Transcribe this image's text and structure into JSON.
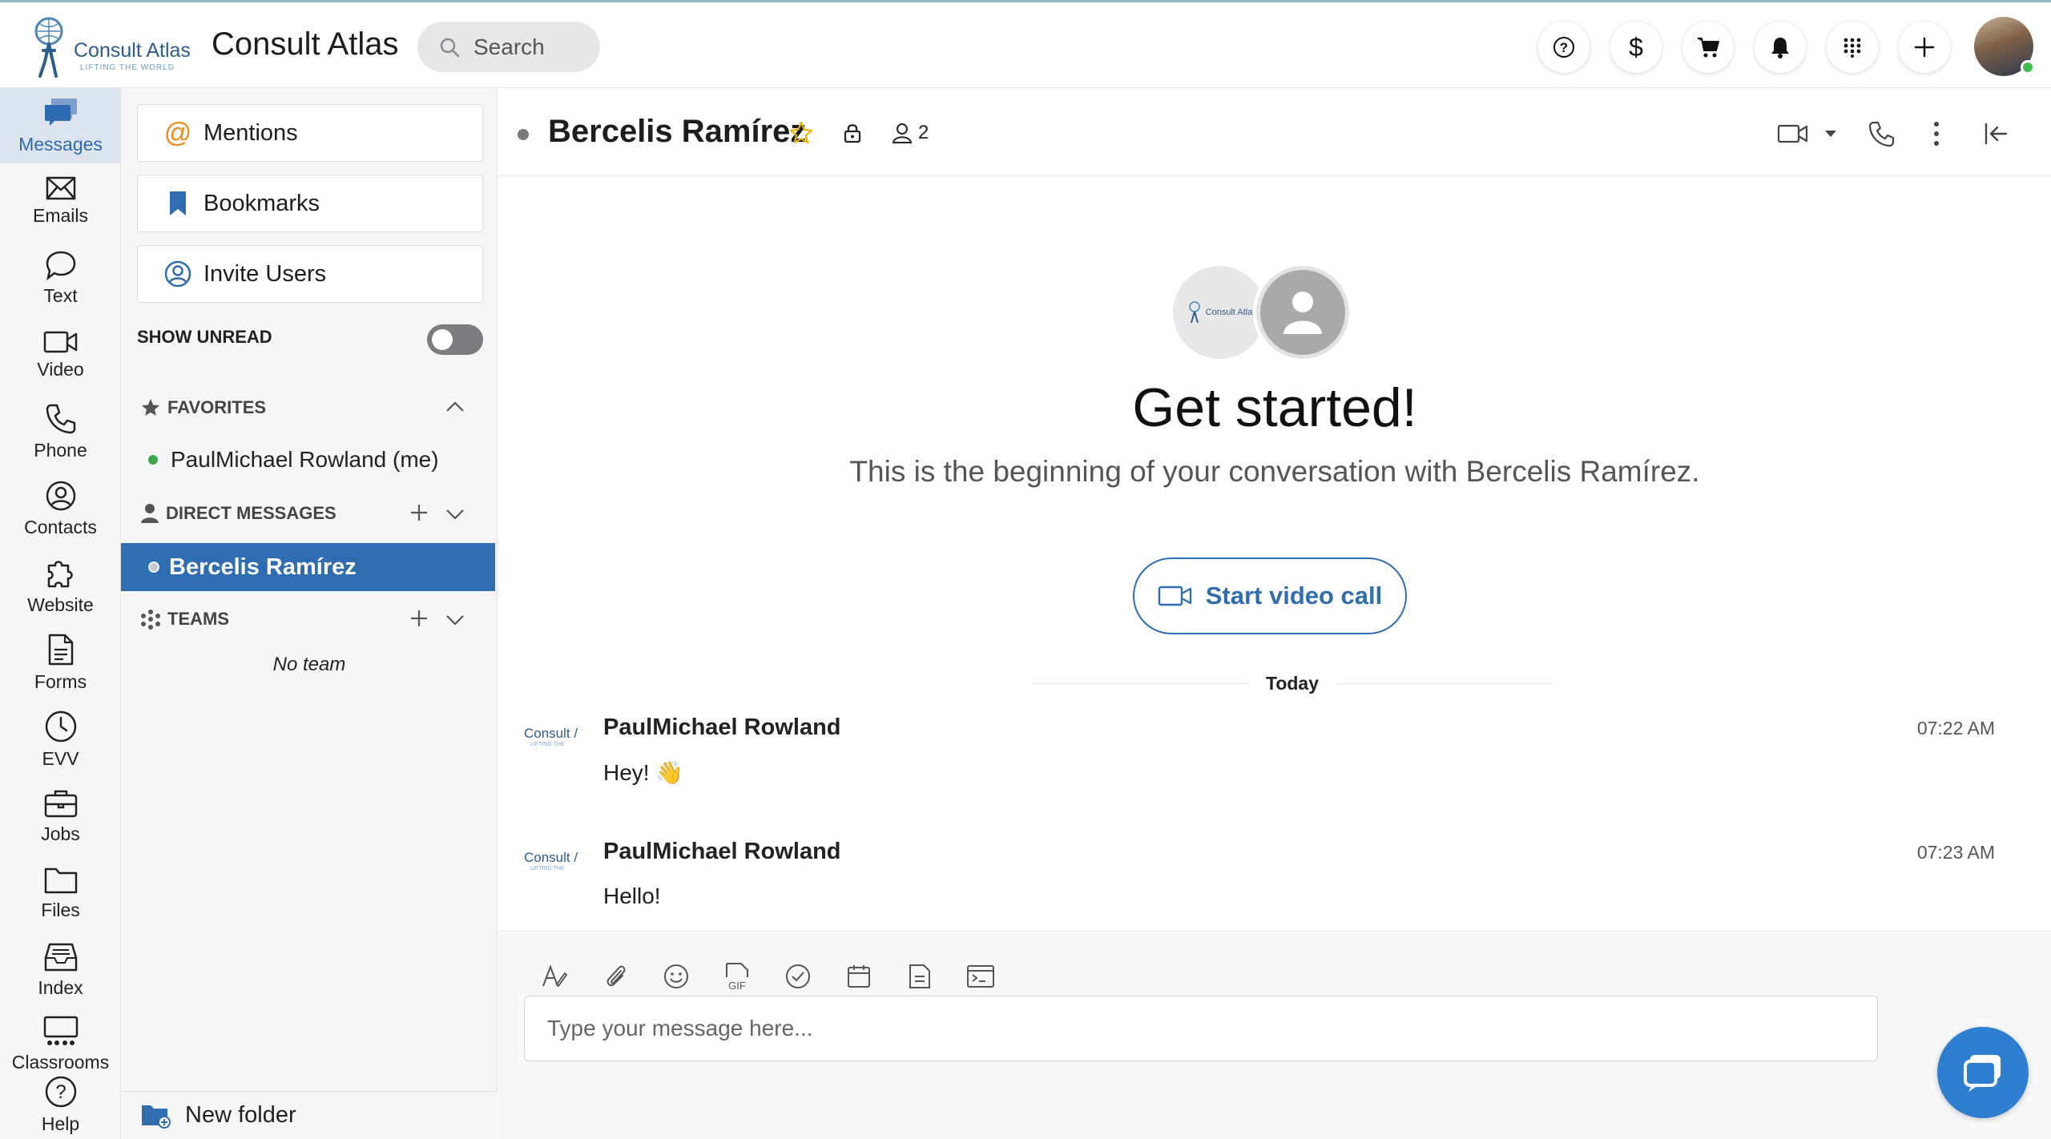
{
  "topbar": {
    "logo_brand": "Consult Atlas",
    "logo_tagline": "LIFTING THE WORLD",
    "app_title": "Consult Atlas",
    "search_placeholder": "Search",
    "buttons": [
      "help-icon",
      "dollar-icon",
      "cart-icon",
      "bell-icon",
      "apps-grid-icon",
      "plus-icon"
    ]
  },
  "rail": {
    "items": [
      {
        "label": "Messages",
        "icon": "messages-icon",
        "active": true
      },
      {
        "label": "Emails",
        "icon": "mail-icon"
      },
      {
        "label": "Text",
        "icon": "chat-bubble-icon"
      },
      {
        "label": "Video",
        "icon": "video-camera-icon"
      },
      {
        "label": "Phone",
        "icon": "phone-icon"
      },
      {
        "label": "Contacts",
        "icon": "contacts-icon"
      },
      {
        "label": "Website",
        "icon": "puzzle-icon"
      },
      {
        "label": "Forms",
        "icon": "document-icon"
      },
      {
        "label": "EVV",
        "icon": "clock-icon"
      },
      {
        "label": "Jobs",
        "icon": "briefcase-icon"
      },
      {
        "label": "Files",
        "icon": "folder-icon"
      },
      {
        "label": "Index",
        "icon": "inbox-icon"
      },
      {
        "label": "Classrooms",
        "icon": "classroom-icon"
      },
      {
        "label": "Help",
        "icon": "help-circle-icon"
      }
    ]
  },
  "sidebar": {
    "mentions": "Mentions",
    "bookmarks": "Bookmarks",
    "invite_users": "Invite Users",
    "show_unread": "SHOW UNREAD",
    "show_unread_on": false,
    "favorites_label": "FAVORITES",
    "favorites": [
      "PaulMichael Rowland (me)"
    ],
    "direct_messages_label": "DIRECT MESSAGES",
    "direct_messages": [
      "Bercelis Ramírez"
    ],
    "teams_label": "TEAMS",
    "no_team": "No team",
    "new_folder": "New folder"
  },
  "channel": {
    "name": "Bercelis Ramírez",
    "member_count": "2",
    "colors": {
      "accent": "#2f6db0",
      "star": "#e8b100"
    }
  },
  "welcome": {
    "avatar_logo_text": "Consult Atla",
    "title": "Get started!",
    "subtitle": "This is the beginning of your conversation with Bercelis Ramírez.",
    "video_button": "Start video call"
  },
  "day_separator": "Today",
  "messages": [
    {
      "logo_text": "Consult /",
      "logo_small": "LIFTING THE",
      "author": "PaulMichael Rowland",
      "time": "07:22 AM",
      "text": "Hey! 👋"
    },
    {
      "logo_text": "Consult /",
      "logo_small": "LIFTING THE",
      "author": "PaulMichael Rowland",
      "time": "07:23 AM",
      "text": "Hello!"
    }
  ],
  "composer": {
    "placeholder": "Type your message here...",
    "tools": [
      "format-icon",
      "attachment-icon",
      "emoji-icon",
      "gif-icon",
      "task-check-icon",
      "calendar-icon",
      "note-icon",
      "code-snippet-icon"
    ],
    "gif_label": "GIF"
  }
}
